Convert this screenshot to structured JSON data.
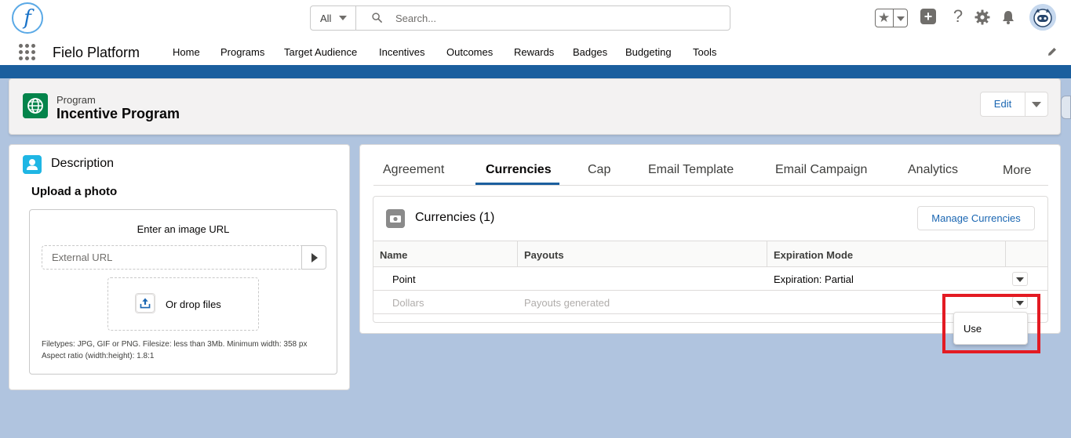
{
  "search": {
    "scope": "All",
    "placeholder": "Search..."
  },
  "header": {
    "app_name": "Fielo Platform",
    "logo_letter": "f"
  },
  "nav": {
    "items": [
      "Home",
      "Programs",
      "Target Audience",
      "Incentives",
      "Outcomes",
      "Rewards",
      "Badges",
      "Budgeting",
      "Tools"
    ]
  },
  "record": {
    "type": "Program",
    "title": "Incentive Program",
    "edit_label": "Edit"
  },
  "description": {
    "title": "Description",
    "upload_title": "Upload a photo",
    "url_label": "Enter an image URL",
    "url_placeholder": "External URL",
    "drop_label": "Or drop files",
    "note_line1": "Filetypes: JPG, GIF or PNG. Filesize: less than 3Mb. Minimum width: 358 px",
    "note_line2": "Aspect ratio (width:height): 1.8:1"
  },
  "tabs": {
    "items": [
      "Agreement",
      "Currencies",
      "Cap",
      "Email Template",
      "Email Campaign",
      "Analytics"
    ],
    "active": "Currencies",
    "more_label": "More"
  },
  "currencies": {
    "title": "Currencies (1)",
    "manage_label": "Manage Currencies",
    "columns": [
      "Name",
      "Payouts",
      "Expiration Mode"
    ],
    "rows": [
      {
        "name": "Point",
        "payouts": "",
        "expiration": "Expiration: Partial"
      },
      {
        "name": "Dollars",
        "payouts": "Payouts generated",
        "expiration": ""
      }
    ],
    "menu_option": "Use"
  },
  "colors": {
    "brand_blue": "#1b5f9e",
    "link_blue": "#1a66b2",
    "program_icon": "#04844b",
    "description_icon": "#1fb6e4",
    "highlight": "#e31b23"
  }
}
